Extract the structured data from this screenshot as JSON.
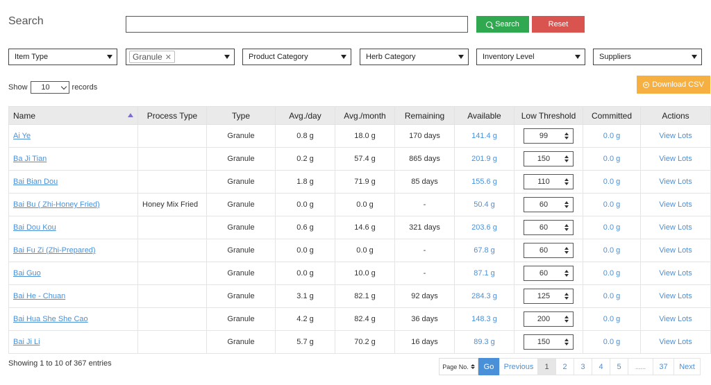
{
  "search": {
    "label": "Search",
    "value": "",
    "search_button": "Search",
    "reset_button": "Reset"
  },
  "filters": [
    {
      "label": "Item Type"
    },
    {
      "label": "",
      "tag": "Granule"
    },
    {
      "label": "Product Category"
    },
    {
      "label": "Herb Category"
    },
    {
      "label": "Inventory Level"
    },
    {
      "label": "Suppliers"
    }
  ],
  "length": {
    "prefix": "Show",
    "value": "10",
    "suffix": "records"
  },
  "download_label": "Download CSV",
  "columns": [
    "Name",
    "Process Type",
    "Type",
    "Avg./day",
    "Avg./month",
    "Remaining",
    "Available",
    "Low Threshold",
    "Committed",
    "Actions"
  ],
  "rows": [
    {
      "name": "Ai Ye",
      "process": "",
      "type": "Granule",
      "day": "0.8 g",
      "month": "18.0 g",
      "remaining": "170 days",
      "available": "141.4 g",
      "threshold": "99",
      "committed": "0.0 g",
      "action": "View Lots"
    },
    {
      "name": "Ba Ji Tian",
      "process": "",
      "type": "Granule",
      "day": "0.2 g",
      "month": "57.4 g",
      "remaining": "865 days",
      "available": "201.9 g",
      "threshold": "150",
      "committed": "0.0 g",
      "action": "View Lots"
    },
    {
      "name": "Bai Bian Dou",
      "process": "",
      "type": "Granule",
      "day": "1.8 g",
      "month": "71.9 g",
      "remaining": "85 days",
      "available": "155.6 g",
      "threshold": "110",
      "committed": "0.0 g",
      "action": "View Lots"
    },
    {
      "name": "Bai Bu ( Zhi-Honey Fried)",
      "process": "Honey Mix Fried",
      "type": "Granule",
      "day": "0.0 g",
      "month": "0.0 g",
      "remaining": "-",
      "available": "50.4 g",
      "threshold": "60",
      "committed": "0.0 g",
      "action": "View Lots"
    },
    {
      "name": "Bai Dou Kou",
      "process": "",
      "type": "Granule",
      "day": "0.6 g",
      "month": "14.6 g",
      "remaining": "321 days",
      "available": "203.6 g",
      "threshold": "60",
      "committed": "0.0 g",
      "action": "View Lots"
    },
    {
      "name": "Bai Fu Zi (Zhi-Prepared)",
      "process": "",
      "type": "Granule",
      "day": "0.0 g",
      "month": "0.0 g",
      "remaining": "-",
      "available": "67.8 g",
      "threshold": "60",
      "committed": "0.0 g",
      "action": "View Lots"
    },
    {
      "name": "Bai Guo",
      "process": "",
      "type": "Granule",
      "day": "0.0 g",
      "month": "10.0 g",
      "remaining": "-",
      "available": "87.1 g",
      "threshold": "60",
      "committed": "0.0 g",
      "action": "View Lots"
    },
    {
      "name": "Bai He - Chuan",
      "process": "",
      "type": "Granule",
      "day": "3.1 g",
      "month": "82.1 g",
      "remaining": "92 days",
      "available": "284.3 g",
      "threshold": "125",
      "committed": "0.0 g",
      "action": "View Lots"
    },
    {
      "name": "Bai Hua She She Cao",
      "process": "",
      "type": "Granule",
      "day": "4.2 g",
      "month": "82.4 g",
      "remaining": "36 days",
      "available": "148.3 g",
      "threshold": "200",
      "committed": "0.0 g",
      "action": "View Lots"
    },
    {
      "name": "Bai Ji Li",
      "process": "",
      "type": "Granule",
      "day": "5.7 g",
      "month": "70.2 g",
      "remaining": "16 days",
      "available": "89.3 g",
      "threshold": "150",
      "committed": "0.0 g",
      "action": "View Lots"
    }
  ],
  "footer": {
    "entries": "Showing 1 to 10 of 367 entries",
    "page_no": "Page No.",
    "go": "Go",
    "previous": "Previous",
    "pages": [
      "1",
      "2",
      "3",
      "4",
      "5",
      "......",
      "37"
    ],
    "next": "Next"
  },
  "colors": {
    "link": "#4a90d9",
    "search_btn": "#2fa84f",
    "reset_btn": "#d9534f",
    "csv_btn": "#f6b042"
  }
}
